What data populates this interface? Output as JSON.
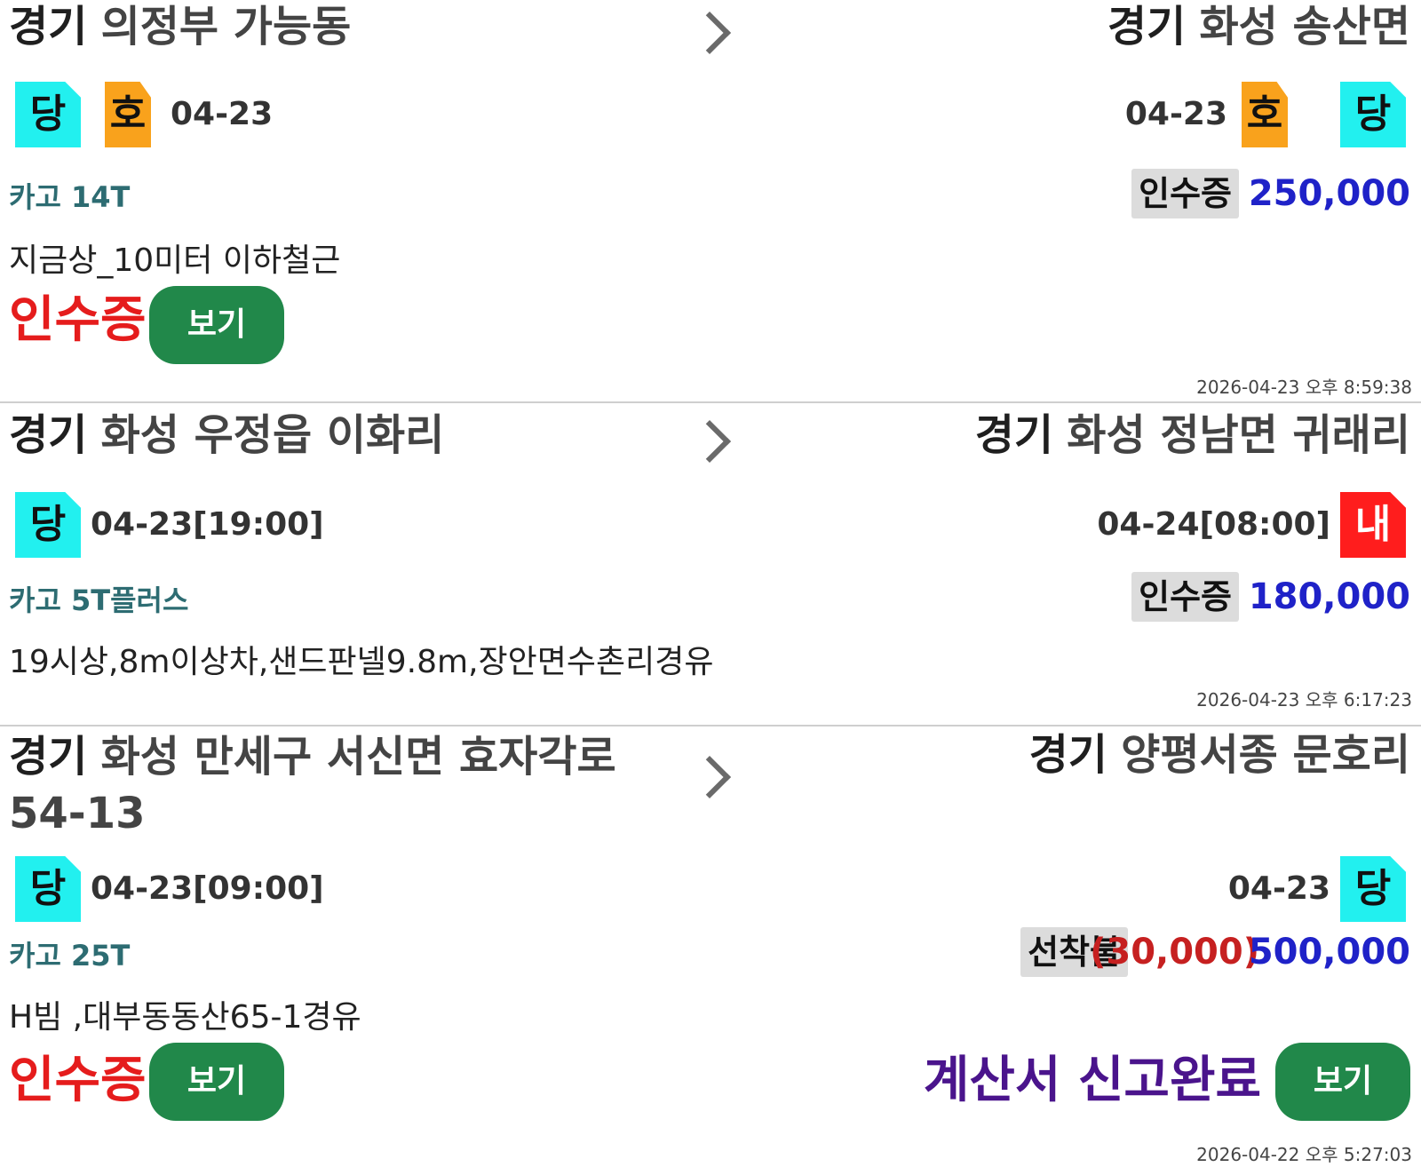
{
  "orders": [
    {
      "origin_region": "경기",
      "origin_address": "의정부 가능동",
      "destination_region": "경기",
      "destination_address": "화성 송산면",
      "origin_badges": [
        "당",
        "호"
      ],
      "origin_date": "04-23",
      "destination_date": "04-23",
      "destination_badges": [
        "호",
        "당"
      ],
      "vehicle": "카고 14T",
      "payment_type": "인수증",
      "amount": "250,000",
      "memo": "지금상_10미터 이하철근",
      "receipt_label": "인수증",
      "view_label": "보기",
      "timestamp": "2026-04-23 오후 8:59:38"
    },
    {
      "origin_region": "경기",
      "origin_address": "화성 우정읍 이화리",
      "destination_region": "경기",
      "destination_address": "화성 정남면 귀래리",
      "origin_badge": "당",
      "origin_date": "04-23[19:00]",
      "destination_date": "04-24[08:00]",
      "destination_badge": "내",
      "vehicle": "카고 5T플러스",
      "payment_type": "인수증",
      "amount": "180,000",
      "memo": "19시상,8m이상차,샌드판넬9.8m,장안면수촌리경유",
      "timestamp": "2026-04-23 오후 6:17:23"
    },
    {
      "origin_region": "경기",
      "origin_address": "화성 만세구 서신면 효자각로 54-13",
      "destination_region": "경기",
      "destination_address": "양평서종 문호리",
      "origin_badge": "당",
      "origin_date": "04-23[09:00]",
      "destination_date": "04-23",
      "destination_badge": "당",
      "vehicle": "카고 25T",
      "payment_type": "선착불",
      "fee": "(30,000)",
      "amount": "500,000",
      "memo": "H빔 ,대부동동산65-1경유",
      "receipt_label": "인수증",
      "view_label": "보기",
      "tax_status": "계산서 신고완료",
      "tax_view_label": "보기",
      "timestamp": "2026-04-22 오후 5:27:03"
    }
  ],
  "colors": {
    "badge_same_day": "#22f0ef",
    "badge_mixed": "#f9a21c",
    "badge_next_day": "#ff1d1d",
    "amount_blue": "#1f22c8",
    "receipt_red": "#e51c1c",
    "view_button_green": "#21884a",
    "tax_status_purple": "#4a148c"
  },
  "icons": {
    "route_arrow": "chevron-right-icon"
  }
}
